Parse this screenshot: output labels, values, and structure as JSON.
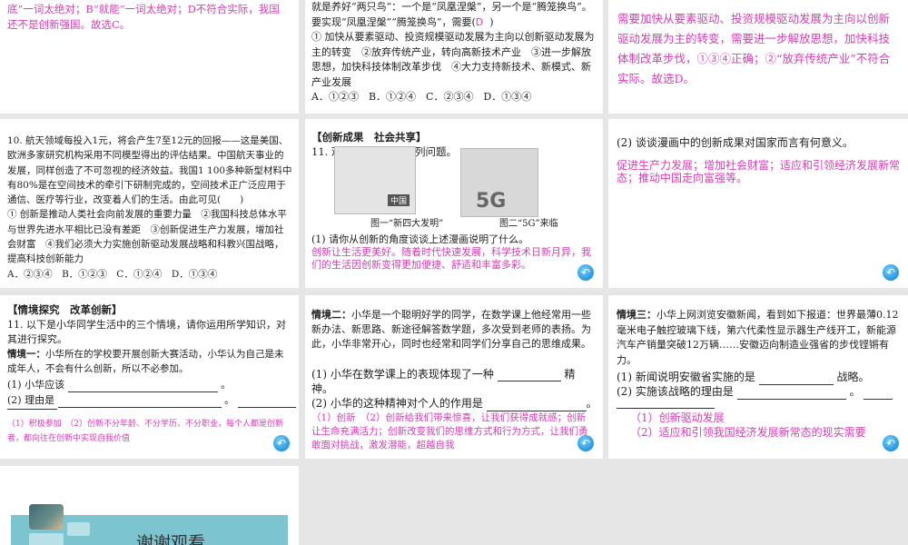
{
  "slides": [
    {
      "answer": "底”一词太绝对；B“就能”一词太绝对；D不符合实际，我国还不是创新强国。故选C。"
    },
    {
      "question": "就是养好“两只鸟”：一个是“凤凰涅槃”，另一个是“腾笼换鸟”。要实现“凤凰涅槃”“腾笼换鸟”，需要(",
      "answer": "D",
      "q_close": ")",
      "items": "① 加快从要素驱动、投资规模驱动发展为主向以创新驱动发展为主的转变　②放弃传统产业，转向高新技术产业　③进一步解放思想，加快科技体制改革步伐　④大力支持新技术、新模式、新产业发展",
      "options": "A．①②③　B．①②④　C．②③④　D．①③④"
    },
    {
      "answer": "需要加快从要素驱动、投资规模驱动发展为主向以创新驱动发展为主的转变，需要进一步解放思想，加快科技体制改革步伐，①③④正确；②“放弃传统产业”不符合实际。故选D。"
    },
    {
      "question": "10. 航天领域每投入1元，将会产生7至12元的回报——这是美国、欧洲多家研究机构采用不同模型得出的评估结果。中国航天事业的发展，同样创造了不可忽视的经济效益。我国1 100多种新型材料中有80%是在空间技术的牵引下研制完成的，空间技术正广泛应用于通信、医疗等行业，改变着人们的生活。由此可见(　　)",
      "items": "① 创新是推动人类社会向前发展的重要力量　②我国科技总体水平与世界先进水平相比已没有差距　③创新促进生产力发展，增加社会财富　④我们必须大力实施创新驱动发展战略和科教兴国战略，提高科技创新能力",
      "options": "A．②③④　B．①②③　C．①②④　D．①③④"
    },
    {
      "heading": "【创新成果　社会共享】",
      "question": "11. 观察漫画，回答下列问题。",
      "caption1": "图一“新四大发明”",
      "caption2": "图二“5G”来临",
      "img1_label": "中国",
      "img2_label": "5G",
      "sub": "(1) 请你从创新的角度谈谈上述漫画说明了什么。",
      "answer": "创新让生活更美好。随着时代快速发展，科学技术日新月异，我们的生活因创新变得更加便捷、舒适和丰富多彩。"
    },
    {
      "sub": "(2) 谈谈漫画中的创新成果对国家而言有何意义。",
      "answer": "促进生产力发展；增加社会财富；适应和引领经济发展新常态；推动中国走向富强等。"
    },
    {
      "heading": "【情境探究　改革创新】",
      "question": "11. 以下是小华同学生活中的三个情境，请你运用所学知识，对其进行探究。",
      "scene_label": "情境一：",
      "scene": "小华所在的学校要开展创新大赛活动，小华认为自己是未成年人，不会有什么创新，所以不必参加。",
      "q1": "(1) 小华应该",
      "q2": "(2) 理由是",
      "answer": "（1）积极参加　（2）创新不分年龄、不分学历、不分职业，每个人都是创新者，都向往在创新中实现自我价值"
    },
    {
      "scene_label": "情境二：",
      "scene": "小华是一个聪明好学的同学，在数学课上他经常用一些新办法、新思路、新途径解答数学题，多次受到老师的表扬。为此，小华非常开心，同时也经常和同学们分享自己的思维成果。",
      "q1": "(1) 小华在数学课上的表现体现了一种",
      "q1_end": "精神。",
      "q2": "(2) 小华的这种精神对个人的作用是",
      "answer": "（1）创新　（2）创新给我们带来惊喜，让我们获得成就感；创新让生命充满活力；创新改变我们的思维方式和行为方式，让我们勇敢面对挑战，激发潜能，超越自我"
    },
    {
      "scene_label": "情境三：",
      "scene": "小华上网浏览安徽新闻，看到如下报道：世界最薄0.12毫米电子触控玻璃下线，第六代柔性显示器生产线开工，新能源汽车产销量突破12万辆……安徽迈向制造业强省的步伐铿锵有力。",
      "q1": "(1) 新闻说明安徽省实施的是",
      "q1_end": "战略。",
      "q2": "(2) 实施该战略的理由是",
      "answer1": "（1）创新驱动发展",
      "answer2": "（2）适应和引领我国经济发展新常态的现实需要"
    },
    {
      "title": "谢谢观看"
    }
  ],
  "icons": {
    "back": "back-arrow-icon"
  },
  "colors": {
    "answer": "#d63cb4",
    "banner": "#7cc4d0"
  }
}
